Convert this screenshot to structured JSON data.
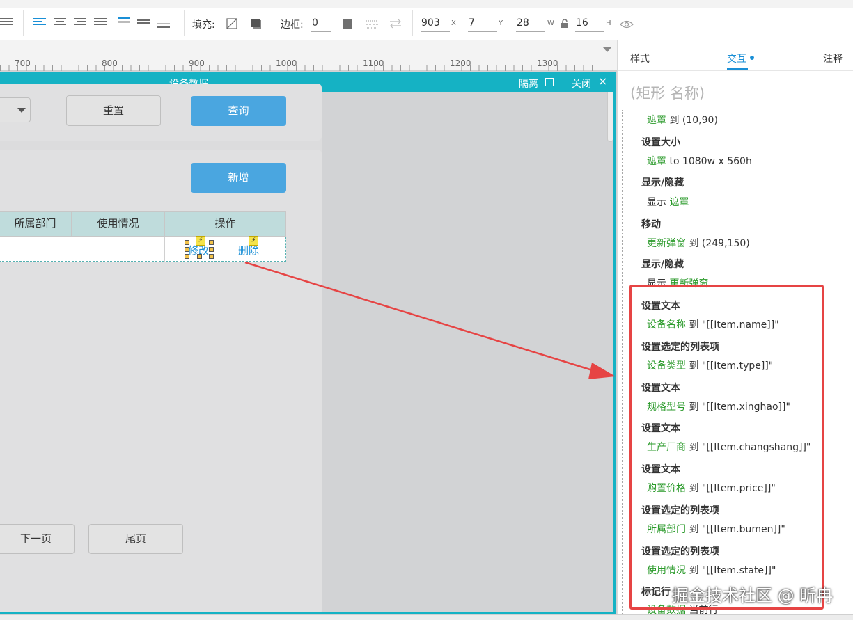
{
  "toolbar": {
    "fill_label": "填充:",
    "border_label": "边框:",
    "border_value": "0",
    "x_value": "903",
    "x_label": "X",
    "y_value": "7",
    "y_label": "Y",
    "w_value": "28",
    "w_label": "W",
    "h_value": "16",
    "h_label": "H"
  },
  "ruler": {
    "marks": [
      "700",
      "800",
      "900",
      "1000",
      "1100",
      "1200",
      "1300"
    ]
  },
  "dialog": {
    "title": "设备数据",
    "isolate_label": "隔离",
    "close_label": "关闭",
    "close_icon": "×"
  },
  "page": {
    "reset_button": "重置",
    "query_button": "查询",
    "add_button": "新增",
    "table": {
      "columns": [
        "所属部门",
        "使用情况",
        "操作"
      ],
      "row": {
        "edit_link": "修改",
        "delete_link": "删除"
      }
    },
    "next_page_button": "下一页",
    "last_page_button": "尾页"
  },
  "right_panel": {
    "tabs": [
      "样式",
      "交互",
      "注释"
    ],
    "name_placeholder": "(矩形 名称)",
    "actions": [
      {
        "line": {
          "target": "遮罩",
          "rest": " 到 (10,90)"
        }
      },
      {
        "title": "设置大小",
        "line": {
          "target": "遮罩",
          "rest": " to 1080w x 560h"
        }
      },
      {
        "title": "显示/隐藏",
        "line": {
          "prefix": "显示 ",
          "target": "遮罩"
        }
      },
      {
        "title": "移动",
        "line": {
          "target": "更新弹窗",
          "rest": " 到 (249,150)"
        }
      },
      {
        "title": "显示/隐藏",
        "line": {
          "prefix": "显示 ",
          "target": "更新弹窗"
        }
      },
      {
        "title": "设置文本",
        "line": {
          "target": "设备名称",
          "rest": " 到 \"[[Item.name]]\""
        }
      },
      {
        "title": "设置选定的列表项",
        "line": {
          "target": "设备类型",
          "rest": " 到 \"[[Item.type]]\""
        }
      },
      {
        "title": "设置文本",
        "line": {
          "target": "规格型号",
          "rest": " 到 \"[[Item.xinghao]]\""
        }
      },
      {
        "title": "设置文本",
        "line": {
          "target": "生产厂商",
          "rest": " 到 \"[[Item.changshang]]\""
        }
      },
      {
        "title": "设置文本",
        "line": {
          "target": "购置价格",
          "rest": " 到 \"[[Item.price]]\""
        }
      },
      {
        "title": "设置选定的列表项",
        "line": {
          "target": "所属部门",
          "rest": " 到 \"[[Item.bumen]]\""
        }
      },
      {
        "title": "设置选定的列表项",
        "line": {
          "target": "使用情况",
          "rest": " 到 \"[[Item.state]]\""
        }
      },
      {
        "title": "标记行",
        "line": {
          "target": "设备数据",
          "rest": " 当前行"
        }
      }
    ]
  },
  "watermark": "掘金技术社区 @ 昕冉",
  "colors": {
    "accent_blue": "#1a8fd6",
    "dialog_teal": "#15b2c4",
    "button_blue": "#4aa6e0",
    "action_green": "#2a9a2a",
    "highlight_red": "#e64444"
  }
}
